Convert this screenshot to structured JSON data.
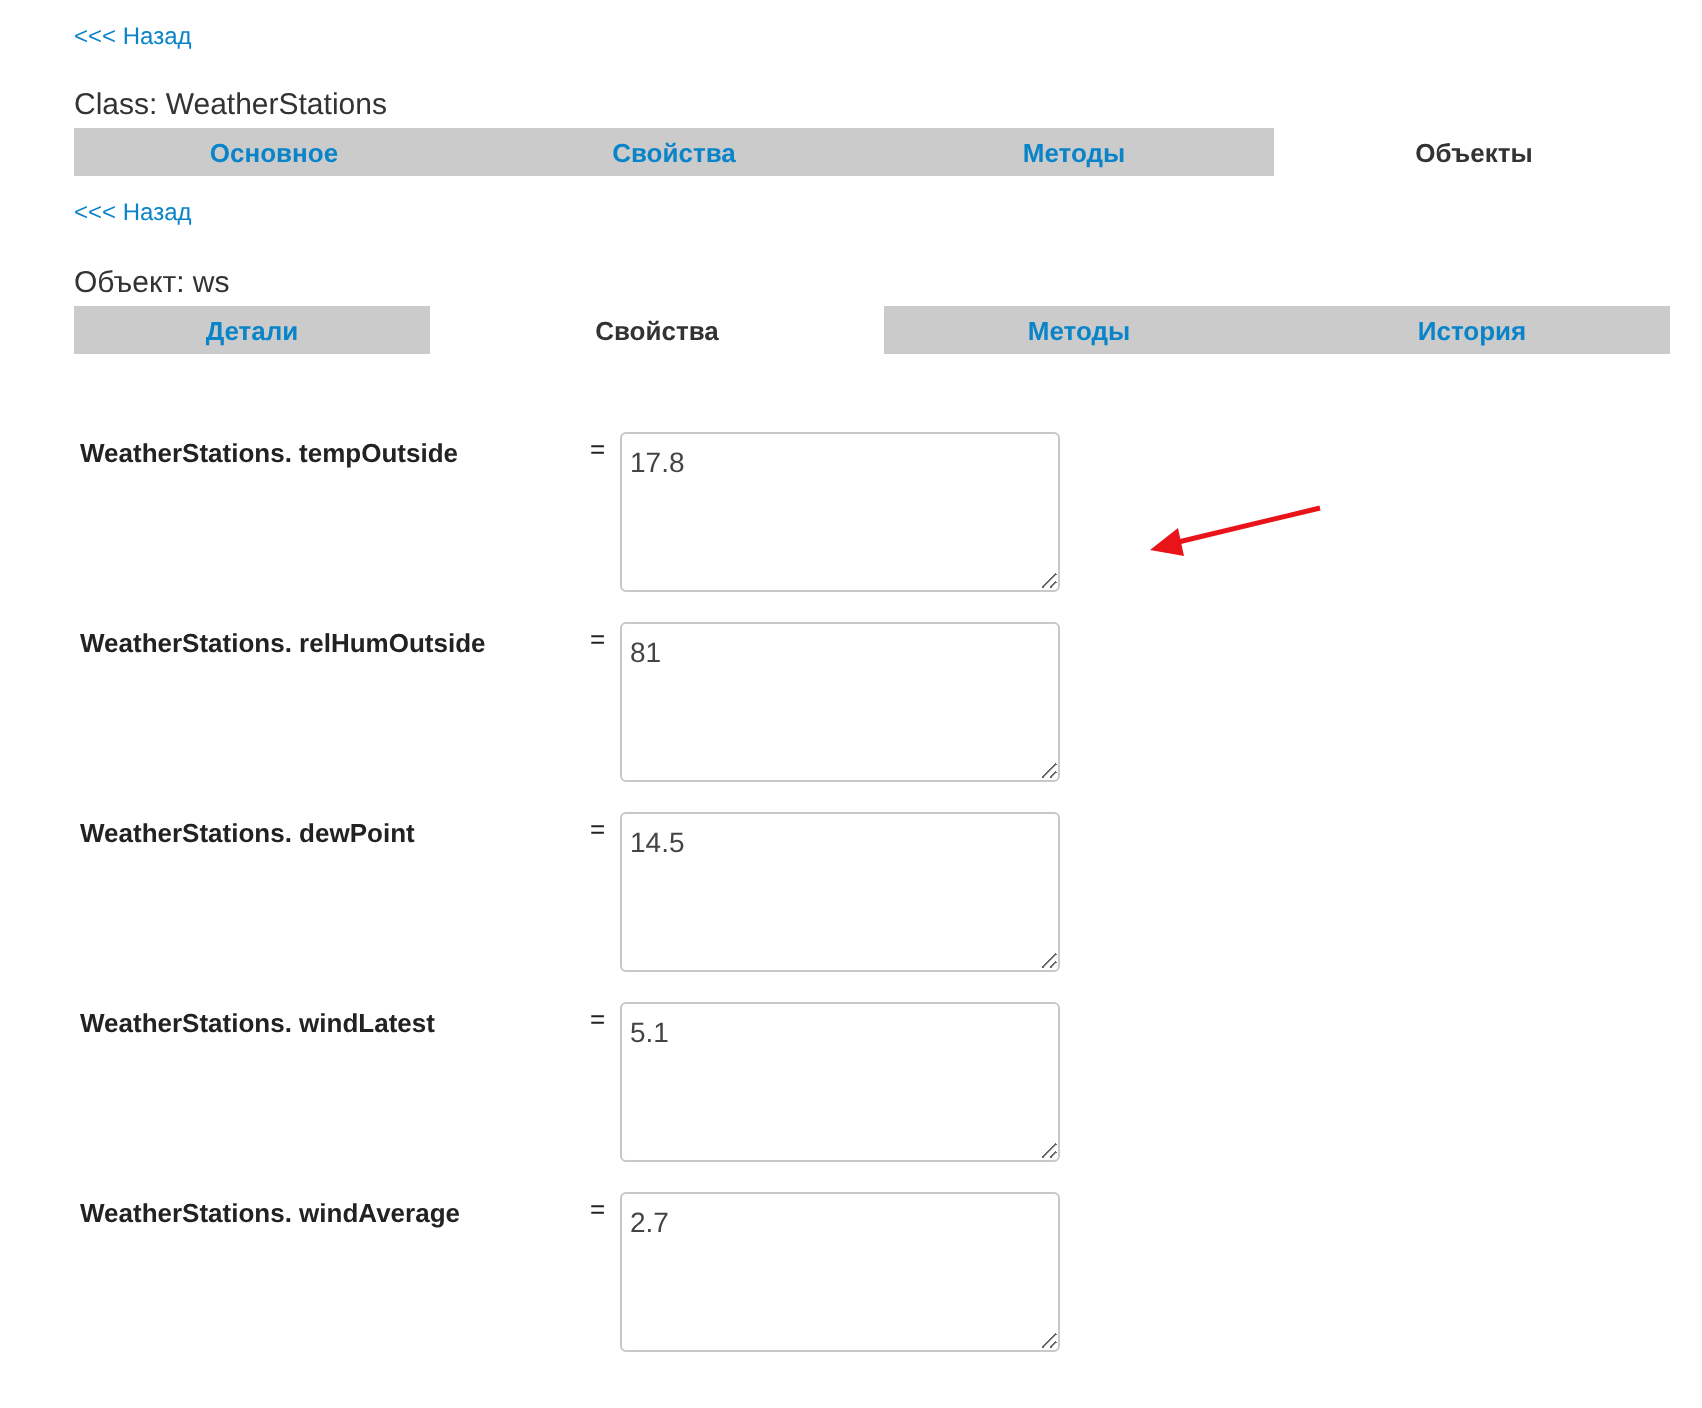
{
  "back_link_top": "<<< Назад",
  "class_heading": "Class: WeatherStations",
  "class_tabs": [
    {
      "label": "Основное",
      "selected": false
    },
    {
      "label": "Свойства",
      "selected": false
    },
    {
      "label": "Методы",
      "selected": false
    },
    {
      "label": "Объекты",
      "selected": true
    }
  ],
  "back_link_object": "<<< Назад",
  "object_heading": "Объект: ws",
  "object_tabs": [
    {
      "label": "Детали",
      "selected": false
    },
    {
      "label": "Свойства",
      "selected": true
    },
    {
      "label": "Методы",
      "selected": false
    },
    {
      "label": "История",
      "selected": false
    }
  ],
  "properties": [
    {
      "name": "WeatherStations. tempOutside",
      "equals": "=",
      "value": "17.8"
    },
    {
      "name": "WeatherStations. relHumOutside",
      "equals": "=",
      "value": "81"
    },
    {
      "name": "WeatherStations. dewPoint",
      "equals": "=",
      "value": "14.5"
    },
    {
      "name": "WeatherStations. windLatest",
      "equals": "=",
      "value": "5.1"
    },
    {
      "name": "WeatherStations. windAverage",
      "equals": "=",
      "value": "2.7"
    }
  ],
  "annotation": {
    "kind": "arrow"
  }
}
